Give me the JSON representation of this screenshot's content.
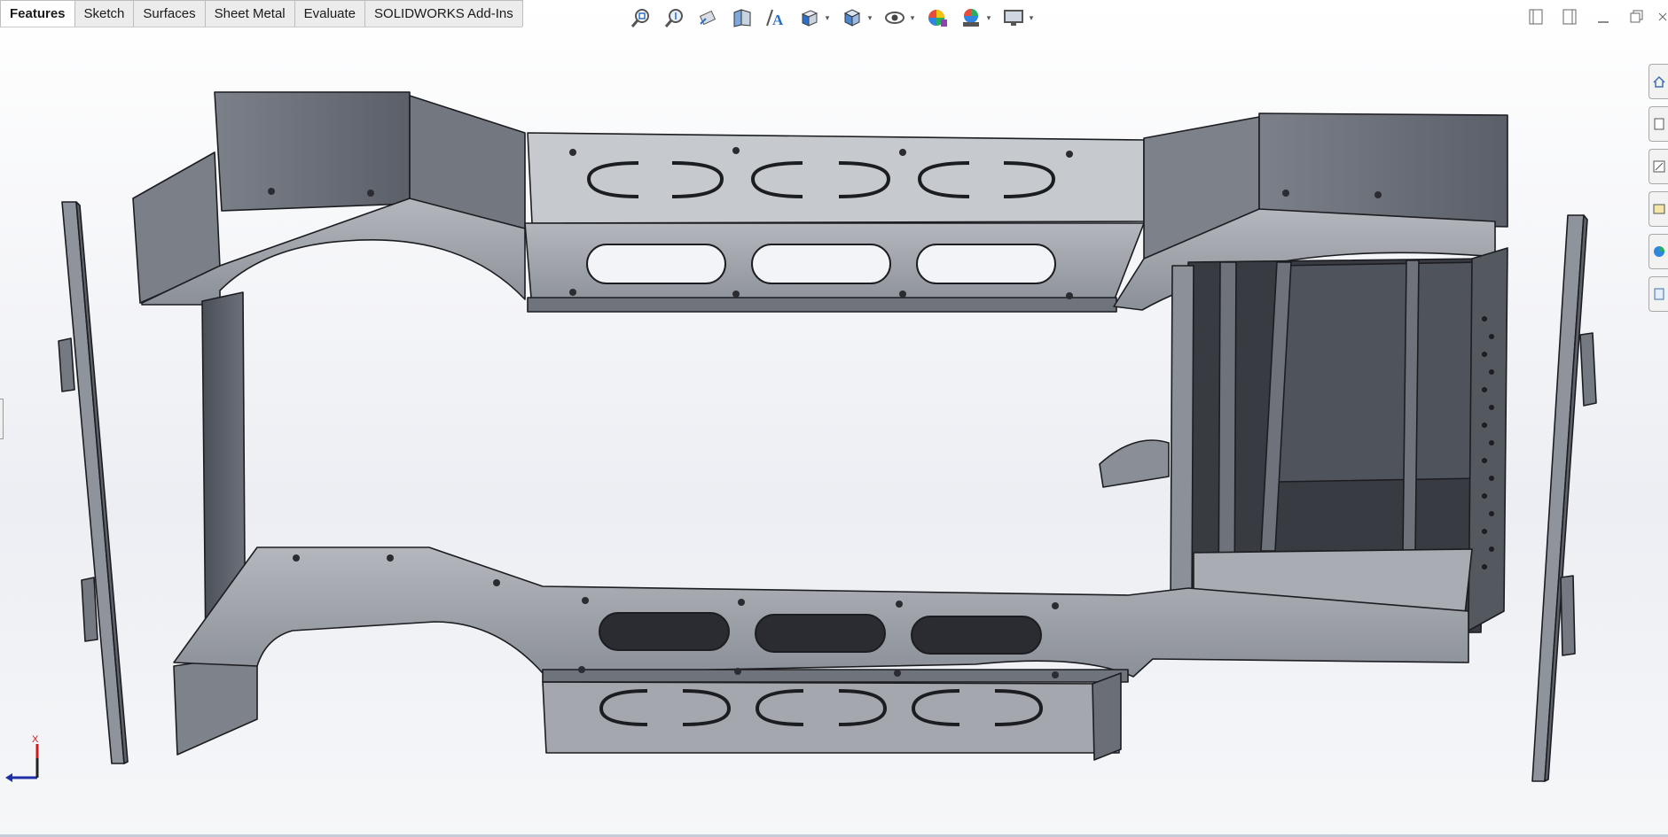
{
  "command_manager": {
    "tabs": [
      {
        "label": "Features",
        "active": true
      },
      {
        "label": "Sketch",
        "active": false
      },
      {
        "label": "Surfaces",
        "active": false
      },
      {
        "label": "Sheet Metal",
        "active": false
      },
      {
        "label": "Evaluate",
        "active": false
      },
      {
        "label": "SOLIDWORKS Add-Ins",
        "active": false
      }
    ]
  },
  "heads_up_toolbar": {
    "icons": [
      "zoom-to-fit-icon",
      "zoom-to-area-icon",
      "previous-view-icon",
      "section-view-icon",
      "dynamic-annotation-icon",
      "view-orientation-icon",
      "display-style-icon",
      "hide-show-items-icon",
      "edit-appearance-icon",
      "apply-scene-icon",
      "view-settings-icon"
    ]
  },
  "window_controls": {
    "icons": [
      "tile-left-icon",
      "tile-right-icon",
      "minimize-icon",
      "restore-icon",
      "close-icon"
    ]
  },
  "task_pane": {
    "icons": [
      "home-icon",
      "design-library-icon",
      "file-explorer-icon",
      "view-palette-icon",
      "appearances-icon",
      "custom-properties-icon"
    ]
  },
  "triad": {
    "x_label": "X"
  },
  "colors": {
    "background_top": "#ffffff",
    "background_mid": "#eceef3",
    "sheet_metal": "#8d9199",
    "sheet_metal_light": "#b3b6bc",
    "sheet_metal_dark": "#4c5058",
    "edge": "#1c1d21",
    "triad_red": "#d01b1b",
    "triad_blue": "#1f2fa8"
  },
  "model": {
    "description_visible": false
  }
}
